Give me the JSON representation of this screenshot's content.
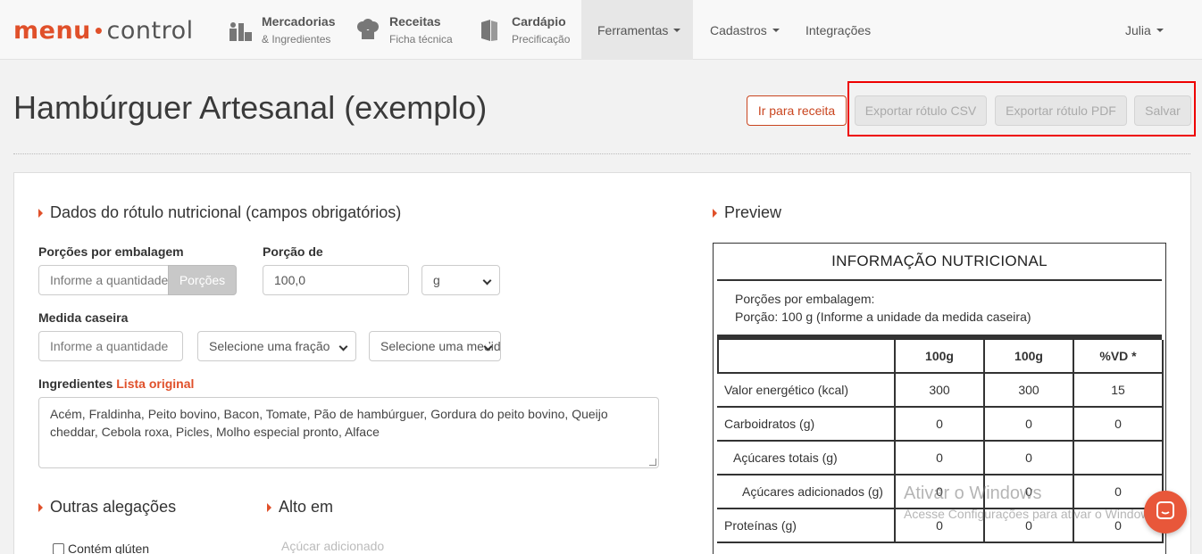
{
  "brand": {
    "part1": "menu",
    "part2": "control"
  },
  "nav": {
    "mercadorias": {
      "title": "Mercadorias",
      "sub": "& Ingredientes"
    },
    "receitas": {
      "title": "Receitas",
      "sub": "Ficha técnica"
    },
    "cardapio": {
      "title": "Cardápio",
      "sub": "Precificação"
    },
    "ferramentas": "Ferramentas",
    "cadastros": "Cadastros",
    "integracoes": "Integrações",
    "user": "Julia"
  },
  "header": {
    "title": "Hambúrguer Artesanal (exemplo)",
    "btn_receita": "Ir para receita",
    "btn_csv": "Exportar rótulo CSV",
    "btn_pdf": "Exportar rótulo PDF",
    "btn_salvar": "Salvar"
  },
  "form": {
    "section_title": "Dados do rótulo nutricional (campos obrigatórios)",
    "porcoes_label": "Porções por embalagem",
    "porcoes_placeholder": "Informe a quantidade",
    "porcoes_addon": "Porções",
    "porcao_de_label": "Porção de",
    "porcao_de_value": "100,0",
    "porcao_unit": "g",
    "medida_label": "Medida caseira",
    "medida_placeholder": "Informe a quantidade",
    "fracao_placeholder": "Selecione uma fração",
    "unidade_placeholder": "Selecione uma medida",
    "ingredientes_label": "Ingredientes",
    "ingredientes_link": "Lista original",
    "ingredientes_text": "Acém, Fraldinha, Peito bovino, Bacon, Tomate, Pão de hambúrguer, Gordura do peito bovino, Queijo cheddar, Cebola roxa, Picles, Molho especial pronto, Alface",
    "outras_title": "Outras alegações",
    "alto_title": "Alto em",
    "contem_gluten": "Contém glúten",
    "acucar_adicionado": "Açúcar adicionado"
  },
  "preview": {
    "section_title": "Preview",
    "table_title": "INFORMAÇÃO NUTRICIONAL",
    "porcoes_line": "Porções por embalagem:",
    "porcao_line": "Porção: 100 g (Informe a unidade da medida caseira)",
    "headers": [
      "",
      "100g",
      "100g",
      "%VD *"
    ],
    "rows": [
      {
        "label": "Valor energético (kcal)",
        "v1": "300",
        "v2": "300",
        "vd": "15"
      },
      {
        "label": "Carboidratos (g)",
        "v1": "0",
        "v2": "0",
        "vd": "0"
      },
      {
        "label": "Açúcares totais (g)",
        "v1": "0",
        "v2": "0",
        "vd": ""
      },
      {
        "label": "Açúcares adicionados (g)",
        "v1": "0",
        "v2": "0",
        "vd": "0"
      },
      {
        "label": "Proteínas (g)",
        "v1": "0",
        "v2": "0",
        "vd": "0"
      }
    ]
  },
  "os": {
    "watermark_title": "Ativar o Windows",
    "watermark_sub": "Acesse Configurações para ativar o Windows."
  },
  "colors": {
    "accent": "#e0502a",
    "highlight": "#ee0000"
  }
}
